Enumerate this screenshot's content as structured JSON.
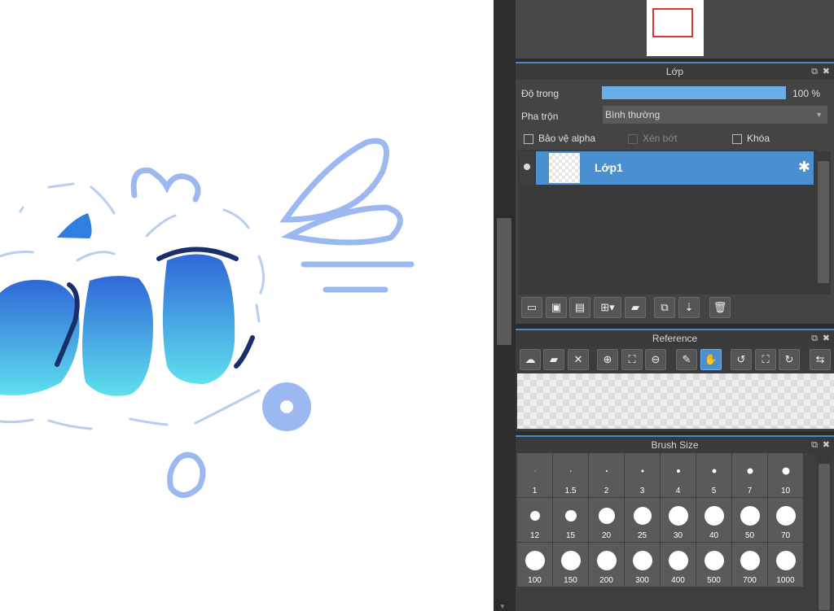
{
  "layer_panel": {
    "title": "Lớp",
    "opacity_label": "Độ trong",
    "opacity_value": "100 %",
    "opacity_fraction": 1.0,
    "blend_label": "Pha trộn",
    "blend_value": "Bình thường",
    "protect_alpha": "Bảo vệ alpha",
    "clipping": "Xén bớt",
    "lock": "Khóa",
    "layers": [
      {
        "name": "Lớp1"
      }
    ]
  },
  "reference_panel": {
    "title": "Reference"
  },
  "brush_panel": {
    "title": "Brush Size",
    "sizes": [
      "1",
      "1.5",
      "2",
      "3",
      "4",
      "5",
      "7",
      "10",
      "12",
      "15",
      "20",
      "25",
      "30",
      "40",
      "50",
      "70",
      "100",
      "150",
      "200",
      "300",
      "400",
      "500",
      "700",
      "1000"
    ]
  },
  "colors": {
    "accent": "#4a8fd0",
    "panel_bg": "#444444"
  }
}
